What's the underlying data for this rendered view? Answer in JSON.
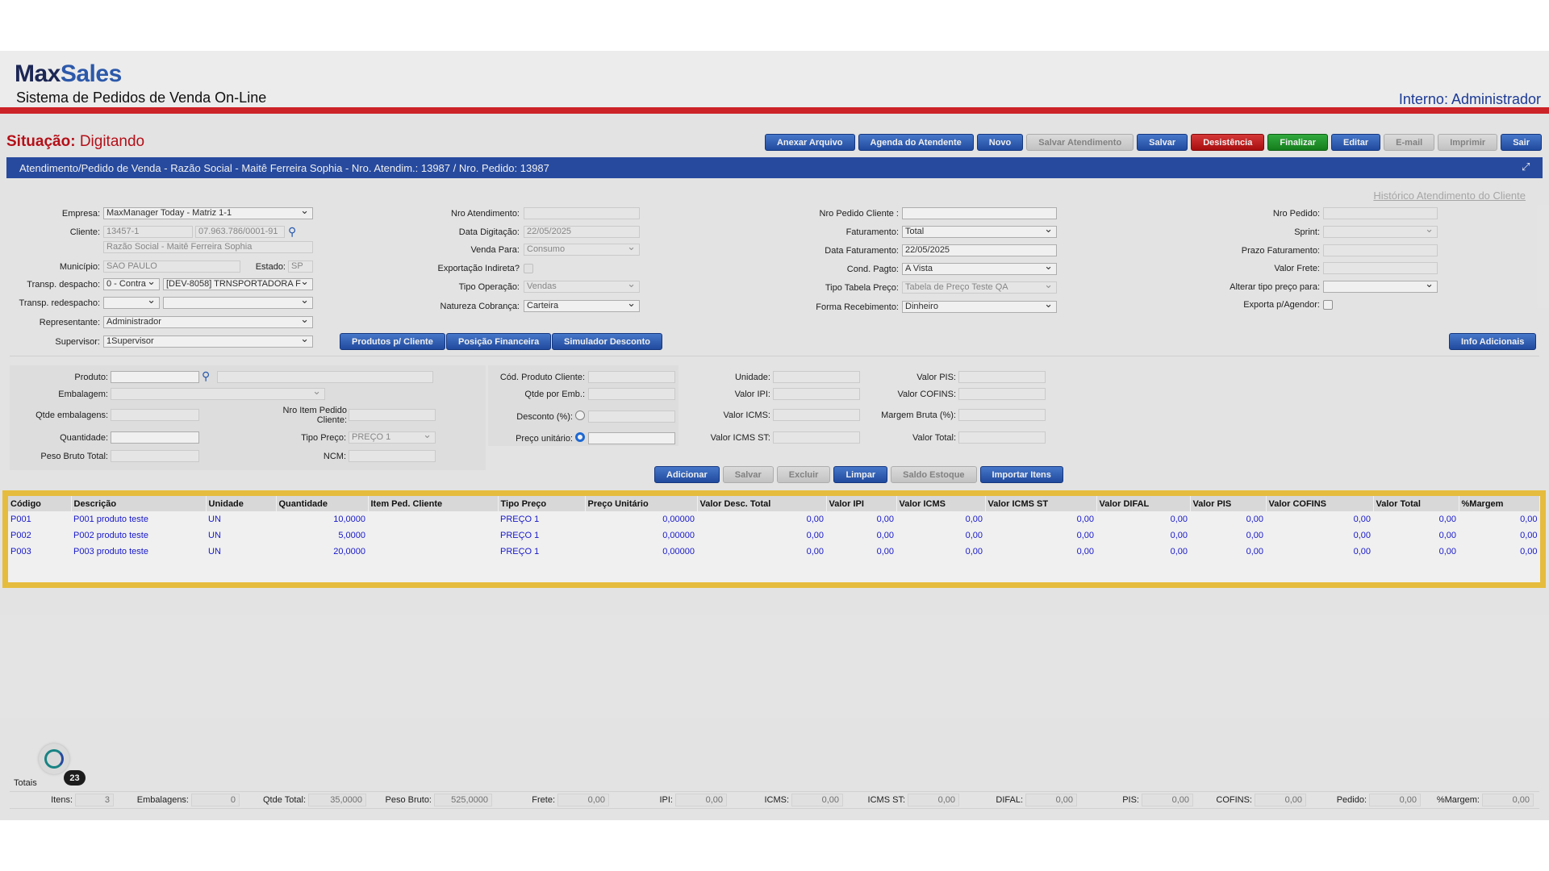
{
  "header": {
    "brand_part1": "Max",
    "brand_part2": "Sales",
    "subtitle": "Sistema de Pedidos de Venda On-Line",
    "user": "Interno: Administrador"
  },
  "status": {
    "label": "Situação:",
    "value": "Digitando"
  },
  "toolbar": [
    {
      "label": "Anexar Arquivo",
      "style": "blue"
    },
    {
      "label": "Agenda do Atendente",
      "style": "blue"
    },
    {
      "label": "Novo",
      "style": "blue"
    },
    {
      "label": "Salvar Atendimento",
      "style": "gray"
    },
    {
      "label": "Salvar",
      "style": "blue"
    },
    {
      "label": "Desistência",
      "style": "red"
    },
    {
      "label": "Finalizar",
      "style": "green"
    },
    {
      "label": "Editar",
      "style": "blue"
    },
    {
      "label": "E-mail",
      "style": "gray"
    },
    {
      "label": "Imprimir",
      "style": "gray"
    },
    {
      "label": "Sair",
      "style": "blue"
    }
  ],
  "title_bar": "Atendimento/Pedido de Venda - Razão Social - Maitê Ferreira Sophia - Nro. Atendim.: 13987 / Nro. Pedido: 13987",
  "history_link": "Histórico Atendimento do Cliente",
  "form": {
    "empresa_label": "Empresa:",
    "empresa_value": "MaxManager Today - Matriz 1-1",
    "cliente_label": "Cliente:",
    "cliente_code": "13457-1",
    "cliente_cnpj": "07.963.786/0001-91",
    "razao_social": "Razão Social - Maitê Ferreira Sophia",
    "municipio_label": "Município:",
    "municipio_value": "SAO PAULO",
    "estado_label": "Estado:",
    "estado_value": "SP",
    "transp_despacho_label": "Transp. despacho:",
    "transp_despacho_type": "0 - Contra",
    "transp_despacho_value": "[DEV-8058] TRNSPORTADORA F",
    "transp_redespacho_label": "Transp. redespacho:",
    "representante_label": "Representante:",
    "representante_value": "Administrador",
    "supervisor_label": "Supervisor:",
    "supervisor_value": "1Supervisor",
    "nro_atendimento_label": "Nro Atendimento:",
    "data_digitacao_label": "Data Digitação:",
    "data_digitacao_value": "22/05/2025",
    "venda_para_label": "Venda Para:",
    "venda_para_value": "Consumo",
    "exportacao_label": "Exportação Indireta?",
    "tipo_operacao_label": "Tipo Operação:",
    "tipo_operacao_value": "Vendas",
    "natureza_label": "Natureza Cobrança:",
    "natureza_value": "Carteira",
    "nro_pedido_cliente_label": "Nro Pedido Cliente :",
    "faturamento_label": "Faturamento:",
    "faturamento_value": "Total",
    "data_faturamento_label": "Data Faturamento:",
    "data_faturamento_value": "22/05/2025",
    "cond_pagto_label": "Cond. Pagto:",
    "cond_pagto_value": "A Vista",
    "tipo_tabela_label": "Tipo Tabela Preço:",
    "tipo_tabela_value": "Tabela de Preço Teste QA",
    "forma_recebimento_label": "Forma Recebimento:",
    "forma_recebimento_value": "Dinheiro",
    "nro_pedido_label": "Nro Pedido:",
    "sprint_label": "Sprint:",
    "prazo_label": "Prazo Faturamento:",
    "valor_frete_label": "Valor Frete:",
    "alterar_tipo_label": "Alterar tipo preço para:",
    "exporta_label": "Exporta p/Agendor:",
    "btn_produtos": "Produtos p/ Cliente",
    "btn_posicao": "Posição Financeira",
    "btn_simulador": "Simulador Desconto",
    "btn_info": "Info Adicionais"
  },
  "product_form": {
    "produto_label": "Produto:",
    "embalagem_label": "Embalagem:",
    "qtde_emb_label": "Qtde embalagens:",
    "nro_item_label1": "Nro Item Pedido",
    "nro_item_label2": "Cliente:",
    "quantidade_label": "Quantidade:",
    "tipo_preco_label": "Tipo Preço:",
    "tipo_preco_value": "PREÇO 1",
    "peso_bruto_label": "Peso Bruto Total:",
    "ncm_label": "NCM:",
    "cod_prod_cliente_label": "Cód. Produto Cliente:",
    "qtde_por_emb_label": "Qtde por Emb.:",
    "desconto_label": "Desconto (%):",
    "preco_unitario_label": "Preço unitário:",
    "unidade_label": "Unidade:",
    "valor_ipi_label": "Valor IPI:",
    "valor_icms_label": "Valor ICMS:",
    "valor_icms_st_label": "Valor ICMS ST:",
    "valor_pis_label": "Valor PIS:",
    "valor_cofins_label": "Valor COFINS:",
    "margem_bruta_label": "Margem Bruta (%):",
    "valor_total_label": "Valor Total:"
  },
  "item_actions": [
    {
      "label": "Adicionar",
      "style": "blue"
    },
    {
      "label": "Salvar",
      "style": "gray"
    },
    {
      "label": "Excluir",
      "style": "gray"
    },
    {
      "label": "Limpar",
      "style": "blue"
    },
    {
      "label": "Saldo Estoque",
      "style": "gray"
    },
    {
      "label": "Importar Itens",
      "style": "blue"
    }
  ],
  "items_table": {
    "columns": [
      "Código",
      "Descrição",
      "Unidade",
      "Quantidade",
      "Item Ped. Cliente",
      "Tipo Preço",
      "Preço Unitário",
      "Valor Desc. Total",
      "Valor IPI",
      "Valor ICMS",
      "Valor ICMS ST",
      "Valor DIFAL",
      "Valor PIS",
      "Valor COFINS",
      "Valor Total",
      "%Margem"
    ],
    "rows": [
      [
        "P001",
        "P001 produto teste",
        "UN",
        "10,0000",
        "",
        "PREÇO 1",
        "0,00000",
        "0,00",
        "0,00",
        "0,00",
        "0,00",
        "0,00",
        "0,00",
        "0,00",
        "0,00",
        "0,00"
      ],
      [
        "P002",
        "P002 produto teste",
        "UN",
        "5,0000",
        "",
        "PREÇO 1",
        "0,00000",
        "0,00",
        "0,00",
        "0,00",
        "0,00",
        "0,00",
        "0,00",
        "0,00",
        "0,00",
        "0,00"
      ],
      [
        "P003",
        "P003 produto teste",
        "UN",
        "20,0000",
        "",
        "PREÇO 1",
        "0,00000",
        "0,00",
        "0,00",
        "0,00",
        "0,00",
        "0,00",
        "0,00",
        "0,00",
        "0,00",
        "0,00"
      ]
    ]
  },
  "chat": {
    "badge": "23"
  },
  "totals": {
    "label": "Totais",
    "fields": [
      {
        "label": "Itens:",
        "value": "3"
      },
      {
        "label": "Embalagens:",
        "value": "0"
      },
      {
        "label": "Qtde Total:",
        "value": "35,0000"
      },
      {
        "label": "Peso Bruto:",
        "value": "525,0000"
      },
      {
        "label": "Frete:",
        "value": "0,00"
      },
      {
        "label": "IPI:",
        "value": "0,00"
      },
      {
        "label": "ICMS:",
        "value": "0,00"
      },
      {
        "label": "ICMS ST:",
        "value": "0,00"
      },
      {
        "label": "DIFAL:",
        "value": "0,00"
      },
      {
        "label": "PIS:",
        "value": "0,00"
      },
      {
        "label": "COFINS:",
        "value": "0,00"
      },
      {
        "label": "Pedido:",
        "value": "0,00"
      },
      {
        "label": "%Margem:",
        "value": "0,00"
      }
    ]
  }
}
